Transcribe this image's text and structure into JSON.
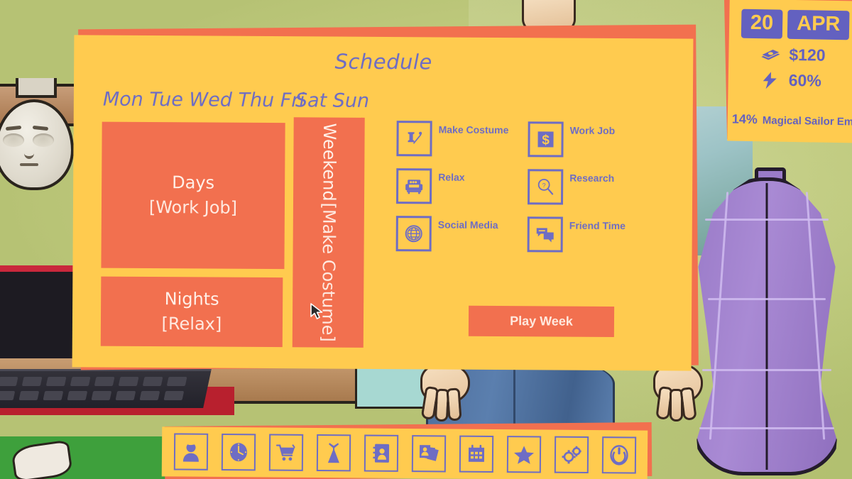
{
  "hud": {
    "day": "20",
    "month": "APR",
    "money": "$120",
    "energy": "60%",
    "money_icon": "money-stack-icon",
    "energy_icon": "lightning-bolt-icon",
    "project_percent": "14%",
    "project_name": "Magical Sailor Empre"
  },
  "panel": {
    "title": "Schedule",
    "weekday_header": "Mon Tue Wed Thu Fri",
    "weekend_header": "Sat Sun",
    "blocks": [
      {
        "name": "days",
        "label": "Days",
        "activity": "[Work Job]"
      },
      {
        "name": "nights",
        "label": "Nights",
        "activity": "[Relax]"
      },
      {
        "name": "weekend",
        "label": "Weekend",
        "activity": "[Make Costume]"
      }
    ],
    "activities": [
      {
        "label": "Make Costume",
        "icon": "thread-spool-needle-icon"
      },
      {
        "label": "Work Job",
        "icon": "dollar-sign-icon"
      },
      {
        "label": "Relax",
        "icon": "sofa-icon"
      },
      {
        "label": "Research",
        "icon": "magnifier-question-icon"
      },
      {
        "label": "Social Media",
        "icon": "globe-icon"
      },
      {
        "label": "Friend Time",
        "icon": "chat-bubbles-icon"
      }
    ],
    "play_button": "Play Week"
  },
  "toolbar": {
    "buttons": [
      {
        "name": "profile",
        "icon": "person-icon"
      },
      {
        "name": "time",
        "icon": "clock-icon"
      },
      {
        "name": "shop",
        "icon": "shopping-cart-icon"
      },
      {
        "name": "wardrobe",
        "icon": "dress-icon"
      },
      {
        "name": "contacts",
        "icon": "address-book-icon"
      },
      {
        "name": "gallery",
        "icon": "photos-icon"
      },
      {
        "name": "calendar",
        "icon": "calendar-icon"
      },
      {
        "name": "favorites",
        "icon": "star-icon"
      },
      {
        "name": "settings",
        "icon": "gears-icon"
      },
      {
        "name": "quit",
        "icon": "power-icon"
      }
    ]
  },
  "colors": {
    "panel_yellow": "#ffcb4f",
    "accent_orange": "#f2704f",
    "accent_purple": "#6e6dc4",
    "badge_purple": "#6361c0"
  }
}
